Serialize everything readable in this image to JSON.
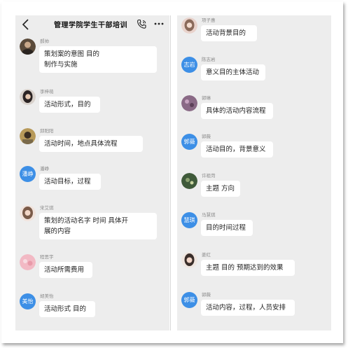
{
  "header": {
    "title": "管理学院学生干部培训"
  },
  "left_messages": [
    {
      "sender": "郝帅",
      "avatar_type": "photo",
      "avatar_color": "#5a4a3a",
      "lines": [
        "策划案的意图  目的",
        "制作与实施"
      ]
    },
    {
      "sender": "李梓萌",
      "avatar_type": "photo",
      "avatar_color": "#3b3030",
      "lines": [
        "活动形式，目的"
      ]
    },
    {
      "sender": "邱阳阳",
      "avatar_type": "photo",
      "avatar_color": "#b89a5a",
      "lines": [
        "活动时间，地点具体流程"
      ]
    },
    {
      "sender": "潘峥",
      "avatar_type": "text",
      "avatar_text": "潘峥",
      "lines": [
        "活动目标，过程"
      ]
    },
    {
      "sender": "宋艾琪",
      "avatar_type": "photo",
      "avatar_color": "#e7c9c0",
      "lines": [
        "策划的活动名字 时间  具体开",
        "展的内容"
      ]
    },
    {
      "sender": "程思宇",
      "avatar_type": "photo",
      "avatar_color": "#f2b9c4",
      "lines": [
        "活动所需费用"
      ]
    },
    {
      "sender": "胡美怡",
      "avatar_type": "text",
      "avatar_text": "美怡",
      "lines": [
        "活动形式 目的"
      ]
    }
  ],
  "right_messages": [
    {
      "sender": "项子惠",
      "avatar_type": "photo",
      "avatar_color": "#e9d3cc",
      "lines": [
        "活动背景目的"
      ]
    },
    {
      "sender": "陈志岩",
      "avatar_type": "text",
      "avatar_text": "志岩",
      "lines": [
        "意义目的主体活动"
      ]
    },
    {
      "sender": "郭琳",
      "avatar_type": "photo",
      "avatar_color": "#8a6a86",
      "lines": [
        "具体的活动内容流程"
      ]
    },
    {
      "sender": "郭薇",
      "avatar_type": "text",
      "avatar_text": "郭薇",
      "lines": [
        "活动目的，背景意义"
      ]
    },
    {
      "sender": "许祖菏",
      "avatar_type": "photo",
      "avatar_color": "#3f5a3a",
      "lines": [
        "主题 方向"
      ]
    },
    {
      "sender": "马慧琪",
      "avatar_type": "text",
      "avatar_text": "慧琪",
      "lines": [
        "目的时间过程"
      ]
    },
    {
      "sender": "姜红",
      "avatar_type": "photo",
      "avatar_color": "#6b5a50",
      "lines": [
        "主题 目的  预期达到的效果"
      ]
    },
    {
      "sender": "郭薇",
      "avatar_type": "text",
      "avatar_text": "郭薇",
      "lines": [
        "活动内容，过程，人员安排"
      ]
    }
  ],
  "colors": {
    "panel_bg": "#ededed",
    "bubble_bg": "#ffffff",
    "text_avatar_bg": "#3d8fe6"
  }
}
